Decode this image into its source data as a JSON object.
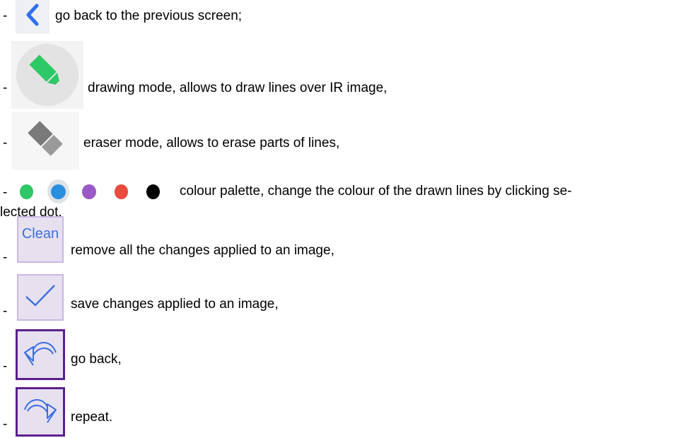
{
  "items": [
    {
      "dash": "-",
      "text": "go back to the previous screen;"
    },
    {
      "dash": "-",
      "text": "drawing mode, allows to draw lines over IR image,"
    },
    {
      "dash": "-",
      "text": "eraser mode, allows to erase parts of lines,"
    },
    {
      "dash": "-",
      "text": "colour palette, change the colour of the drawn lines by clicking se-",
      "text2": "lected dot,"
    },
    {
      "dash": "-",
      "text": "remove all the changes applied to an image,",
      "button_label": "Clean"
    },
    {
      "dash": "-",
      "text": "save changes applied to an image,"
    },
    {
      "dash": "-",
      "text": "go back,"
    },
    {
      "dash": "-",
      "text": "repeat."
    }
  ],
  "palette": [
    {
      "name": "green",
      "color": "#2ec866"
    },
    {
      "name": "blue",
      "color": "#2b8fe0"
    },
    {
      "name": "purple",
      "color": "#9b59c6"
    },
    {
      "name": "red",
      "color": "#e74c3c"
    },
    {
      "name": "black",
      "color": "#000000"
    }
  ],
  "icons": {
    "back": "chevron-left-icon",
    "draw": "pencil-icon",
    "erase": "eraser-icon",
    "save": "checkmark-icon",
    "undo": "undo-icon",
    "redo": "redo-icon"
  },
  "colors": {
    "accent_blue": "#3b6fe0",
    "pencil_green": "#2ec866",
    "button_bg": "#e7e1ef",
    "button_border_dark": "#5b1f8f"
  }
}
